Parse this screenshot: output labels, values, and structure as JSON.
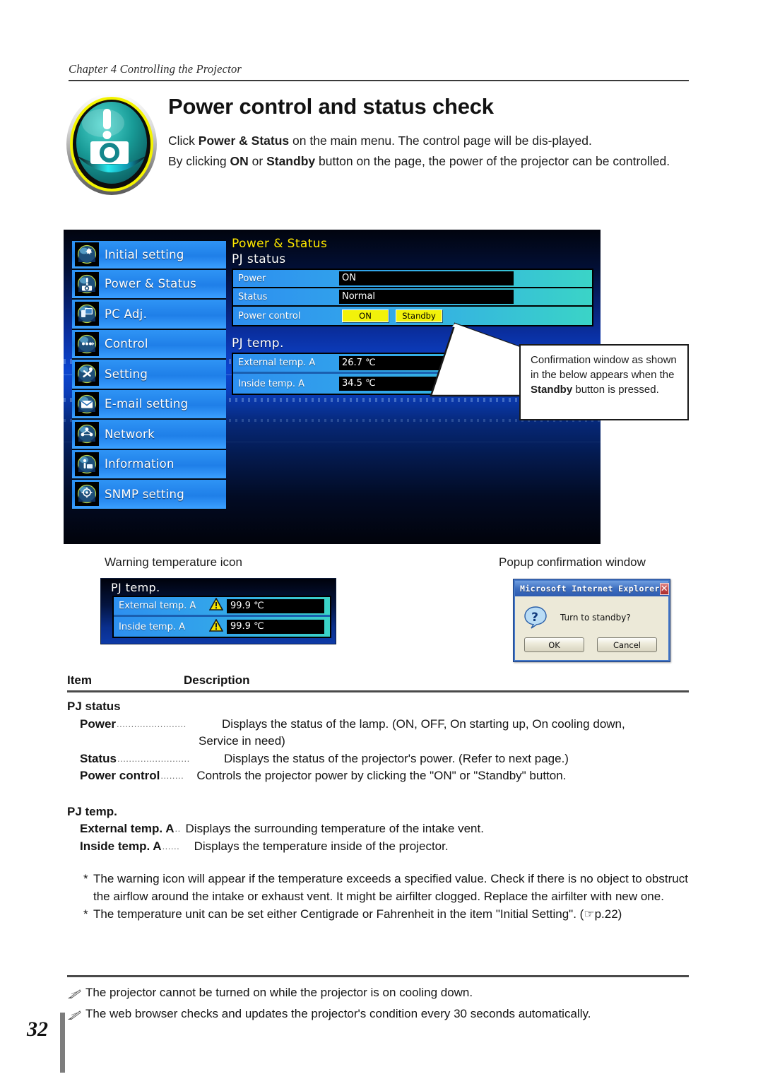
{
  "chapter": "Chapter 4 Controlling the Projector",
  "title": "Power control and status check",
  "intro": {
    "line1_a": "Click ",
    "line1_b": "Power & Status",
    "line1_c": " on the main menu. The control page will be dis-played.",
    "line2_a": "By clicking ",
    "line2_b": "ON",
    "line2_c": " or ",
    "line2_d": "Standby",
    "line2_e": " button on the page, the power of the projector can be controlled."
  },
  "screenshot": {
    "nav": [
      {
        "label": "Initial setting",
        "icon": "gear-globe-icon"
      },
      {
        "label": "Power & Status",
        "icon": "power-status-icon"
      },
      {
        "label": "PC Adj.",
        "icon": "monitor-icon"
      },
      {
        "label": "Control",
        "icon": "remote-control-icon"
      },
      {
        "label": "Setting",
        "icon": "tools-icon"
      },
      {
        "label": "E-mail setting",
        "icon": "envelope-icon"
      },
      {
        "label": "Network",
        "icon": "network-icon"
      },
      {
        "label": "Information",
        "icon": "info-icon"
      },
      {
        "label": "SNMP setting",
        "icon": "snmp-icon"
      }
    ],
    "pane_title": "Power & Status",
    "pj_status": {
      "heading": "PJ status",
      "rows": [
        {
          "key": "Power",
          "value": "ON"
        },
        {
          "key": "Status",
          "value": "Normal"
        }
      ],
      "power_control_key": "Power control",
      "btn_on": "ON",
      "btn_standby": "Standby"
    },
    "pj_temp": {
      "heading": "PJ temp.",
      "rows": [
        {
          "key": "External temp. A",
          "value": "26.7 ℃"
        },
        {
          "key": "Inside temp. A",
          "value": "34.5 ℃"
        }
      ]
    }
  },
  "callout": {
    "a": "Confirmation window  as shown in the below appears when the ",
    "b": "Standby",
    "c": " button is pressed."
  },
  "figures": {
    "warning_caption": "Warning temperature icon",
    "popup_caption": "Popup confirmation window",
    "warning_fig": {
      "heading": "PJ temp.",
      "rows": [
        {
          "key": "External temp. A",
          "value": "99.9 ℃",
          "icon": "warning-triangle-icon"
        },
        {
          "key": "Inside temp. A",
          "value": "99.9 ℃",
          "icon": "warning-triangle-icon"
        }
      ]
    },
    "ie_dialog": {
      "title": "Microsoft Internet Explorer",
      "close": "✕",
      "message": "Turn to standby?",
      "ok": "OK",
      "cancel": "Cancel"
    }
  },
  "table": {
    "col_item": "Item",
    "col_description": "Description",
    "groups": [
      {
        "name": "PJ status",
        "rows": [
          {
            "term": "Power",
            "dots": "........................",
            "desc": "Displays the status of the lamp. (ON, OFF, On starting up, On cooling down,",
            "desc2": "Service in need)"
          },
          {
            "term": "Status",
            "dots": ".........................",
            "desc": "Displays the status of the projector's power. (Refer to next page.)"
          },
          {
            "term": "Power control",
            "dots": "........",
            "desc": "Controls the projector power by clicking the \"ON\" or \"Standby\" button."
          }
        ]
      },
      {
        "name": "PJ temp.",
        "rows": [
          {
            "term": "External temp. A",
            "dots": "..",
            "desc": "Displays the surrounding temperature of the intake vent."
          },
          {
            "term": "Inside temp. A",
            "dots": "......",
            "desc": "Displays the temperature inside of the projector."
          }
        ]
      }
    ]
  },
  "notes": [
    {
      "marker": "*",
      "text": "The warning icon will appear if the temperature exceeds a specified value. Check if there is no object to obstruct the airflow around the intake or exhaust vent. It might be airfilter clogged. Replace the airfilter with new one."
    },
    {
      "marker": "*",
      "text": "The temperature unit can be set either Centigrade or Fahrenheit in the item \"Initial Setting\". (☞p.22)"
    }
  ],
  "pencil_notes": [
    "The projector cannot be turned on while the projector is on cooling down.",
    "The web browser checks and updates the projector's condition every 30 seconds automatically."
  ],
  "page_number": "32",
  "colors": {
    "yellow_button": "#f2f20a",
    "pane_title": "#ffe900",
    "nav_blue": "#2f94f5",
    "table_teal": "#3ad6c6",
    "ie_face": "#ece9d8"
  }
}
